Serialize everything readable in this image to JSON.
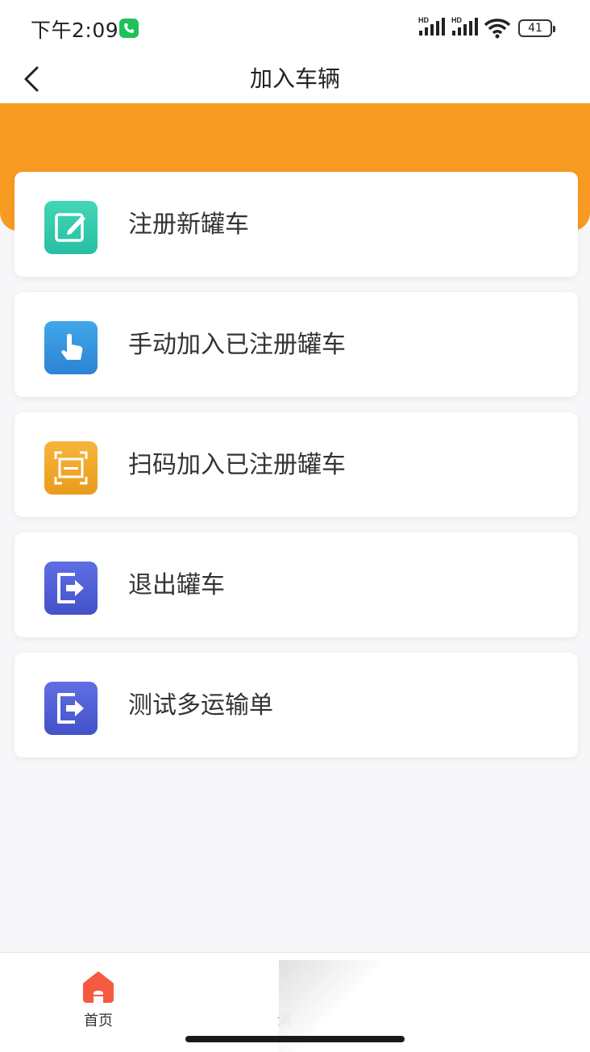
{
  "status_bar": {
    "time": "下午2:09",
    "signal_1_label": "HD",
    "signal_2_label": "HD",
    "battery": "41"
  },
  "header": {
    "title": "加入车辆",
    "back_icon": "chevron-left-icon"
  },
  "colors": {
    "accent": "#f89b22",
    "register_icon": "#2cc5a6",
    "manual_icon": "#2e8fdc",
    "scan_icon": "#f2a225",
    "exit_icon": "#4b5bd6",
    "home_tab": "#f45a3f"
  },
  "menu": {
    "items": [
      {
        "label": "注册新罐车",
        "icon": "edit-icon"
      },
      {
        "label": "手动加入已注册罐车",
        "icon": "tap-finger-icon"
      },
      {
        "label": "扫码加入已注册罐车",
        "icon": "scan-icon"
      },
      {
        "label": "退出罐车",
        "icon": "exit-icon"
      },
      {
        "label": "测试多运输单",
        "icon": "exit-icon"
      }
    ]
  },
  "tabbar": {
    "tabs": [
      {
        "label": "首页",
        "icon": "home-icon",
        "active": true
      },
      {
        "label": "消",
        "icon": "message-icon",
        "active": false
      }
    ]
  }
}
